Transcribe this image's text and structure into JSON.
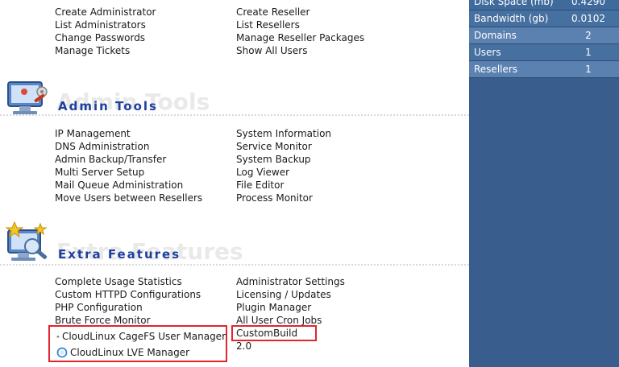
{
  "accounts": {
    "col1": [
      "Create Administrator",
      "List Administrators",
      "Change Passwords",
      "Manage Tickets"
    ],
    "col2": [
      "Create Reseller",
      "List Resellers",
      "Manage Reseller Packages",
      "Show All Users"
    ]
  },
  "admin_tools": {
    "title": "Admin Tools",
    "ghost": "Admin Tools",
    "col1": [
      "IP Management",
      "DNS Administration",
      "Admin Backup/Transfer",
      "Multi Server Setup",
      "Mail Queue Administration",
      "Move Users between Resellers"
    ],
    "col2": [
      "System Information",
      "Service Monitor",
      "System Backup",
      "Log Viewer",
      "File Editor",
      "Process Monitor"
    ]
  },
  "extra_features": {
    "title": "Extra Features",
    "ghost": "Extra Features",
    "col1": [
      "Complete Usage Statistics",
      "Custom HTTPD Configurations",
      "PHP Configuration",
      "Brute Force Monitor"
    ],
    "col2": [
      "Administrator Settings",
      "Licensing / Updates",
      "Plugin Manager",
      "All User Cron Jobs"
    ],
    "highlight_left": [
      {
        "label": "CloudLinux CageFS User Manager",
        "icon": "cagefs-icon"
      },
      {
        "label": "CloudLinux LVE Manager",
        "icon": "lve-icon"
      }
    ],
    "highlight_right": "CustomBuild 2.0"
  },
  "sidebar": {
    "stats": [
      {
        "label": "Disk Space (mb)",
        "value": "0.4290"
      },
      {
        "label": "Bandwidth (gb)",
        "value": "0.0102"
      },
      {
        "label": "Domains",
        "value": "2"
      },
      {
        "label": "Users",
        "value": "1"
      },
      {
        "label": "Resellers",
        "value": "1"
      }
    ]
  },
  "colors": {
    "title_blue": "#1d3f9f",
    "sidebar_bg": "#395d8c",
    "highlight_red": "#e0252f"
  }
}
